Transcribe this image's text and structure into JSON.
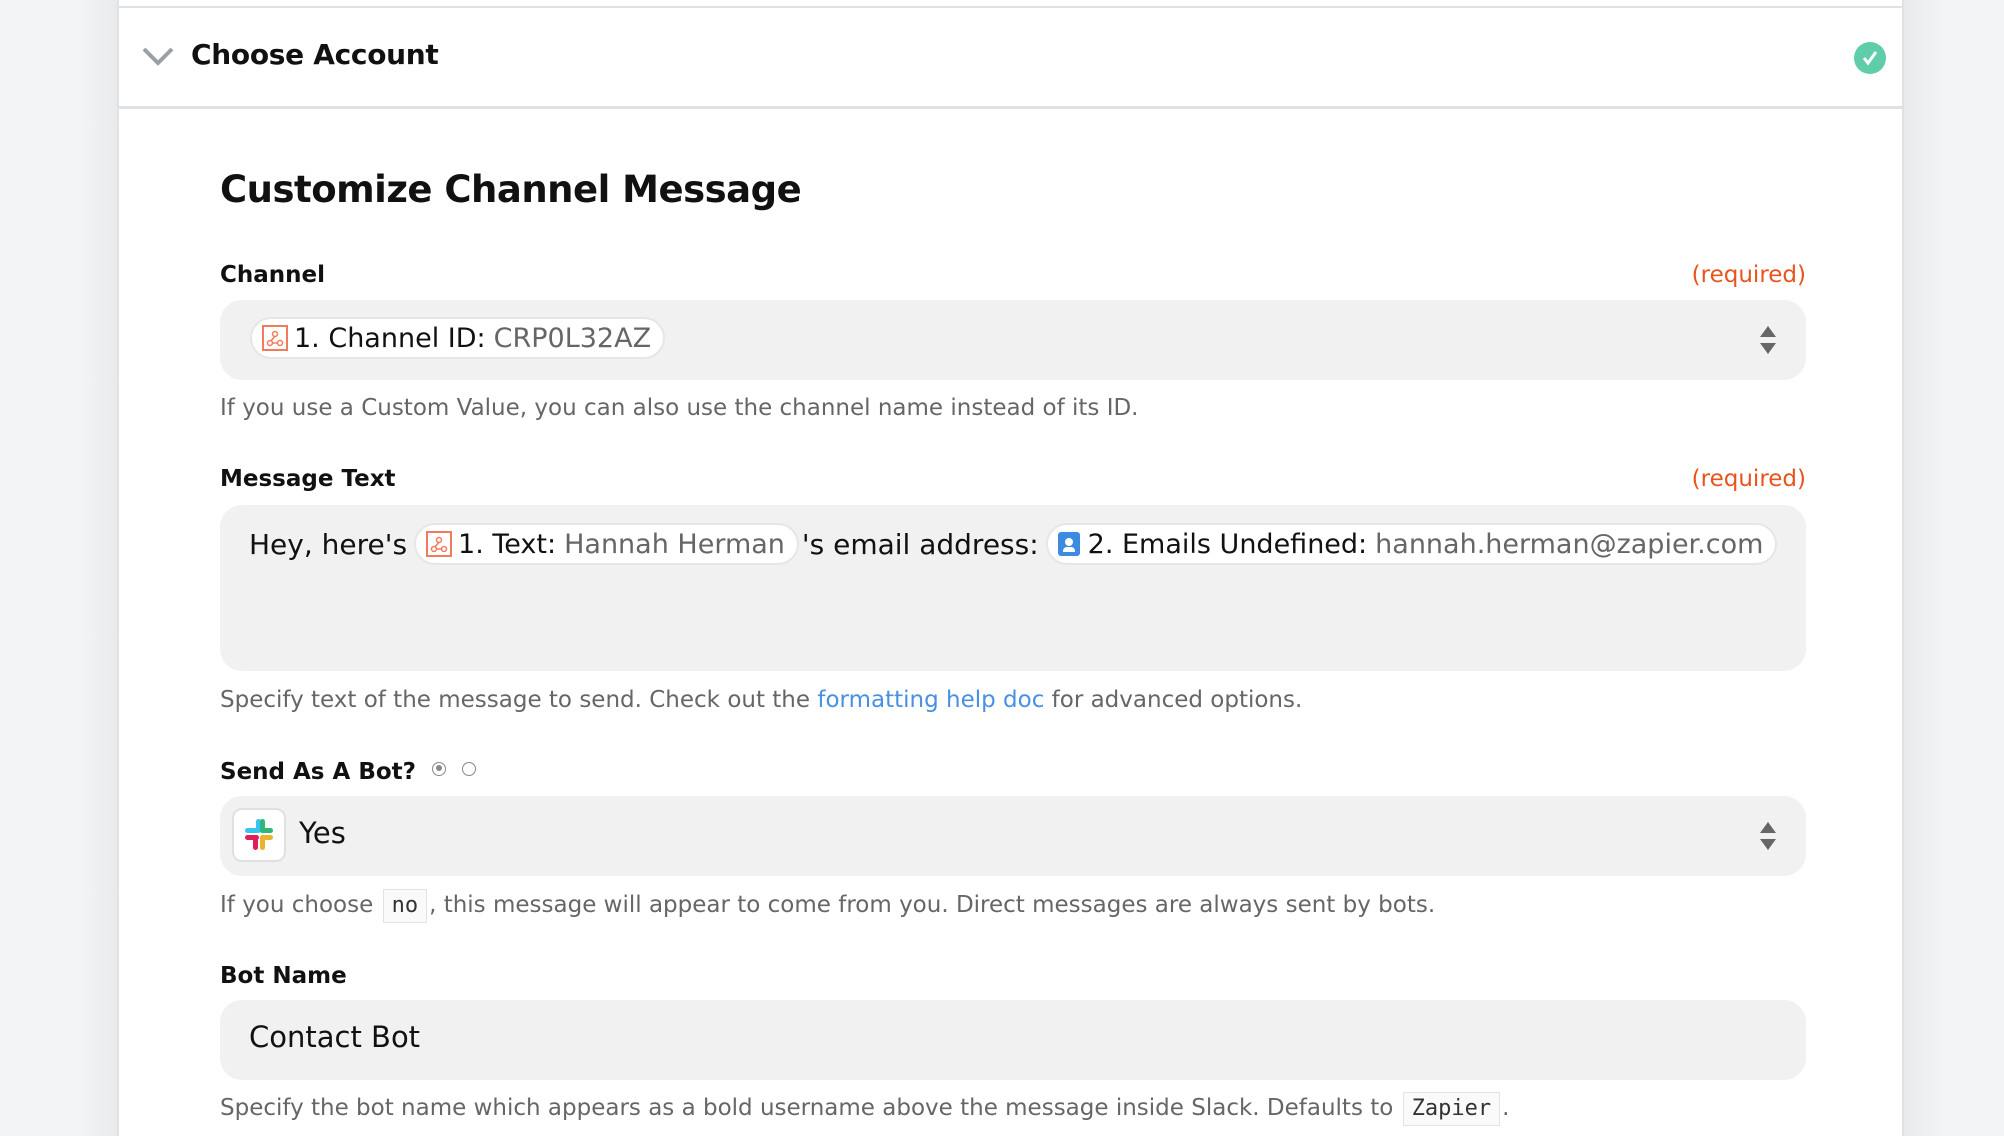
{
  "header": {
    "title": "Choose Account",
    "status": "complete"
  },
  "section": {
    "title": "Customize Channel Message"
  },
  "fields": {
    "channel": {
      "label": "Channel",
      "required": "(required)",
      "pill_label": "1. Channel ID:",
      "pill_value": "CRP0L32AZ",
      "pill_icon": "webhook-icon",
      "help": "If you use a Custom Value, you can also use the channel name instead of its ID."
    },
    "message_text": {
      "label": "Message Text",
      "required": "(required)",
      "text_before": "Hey, here's",
      "pill1_label": "1. Text:",
      "pill1_value": "Hannah Herman",
      "pill1_icon": "webhook-icon",
      "text_middle": "'s email address:",
      "pill2_label": "2. Emails Undefined:",
      "pill2_value": "hannah.herman@zapier.com",
      "pill2_icon": "contacts-icon",
      "help_before": "Specify text of the message to send. Check out the ",
      "help_link": "formatting help doc",
      "help_after": " for advanced options."
    },
    "send_as_bot": {
      "label": "Send As A Bot?",
      "radio_options": [
        "selected",
        "unselected"
      ],
      "value": "Yes",
      "value_icon": "slack-icon",
      "help_before": "If you choose ",
      "help_code": "no",
      "help_after": ", this message will appear to come from you. Direct messages are always sent by bots."
    },
    "bot_name": {
      "label": "Bot Name",
      "value": "Contact Bot",
      "help_before": "Specify the bot name which appears as a bold username above the message inside Slack. Defaults to ",
      "help_code": "Zapier",
      "help_after": "."
    }
  },
  "colors": {
    "required": "#e8541e",
    "link": "#4a90e2",
    "success": "#5fcda9",
    "field_bg": "#f1f1f1"
  }
}
